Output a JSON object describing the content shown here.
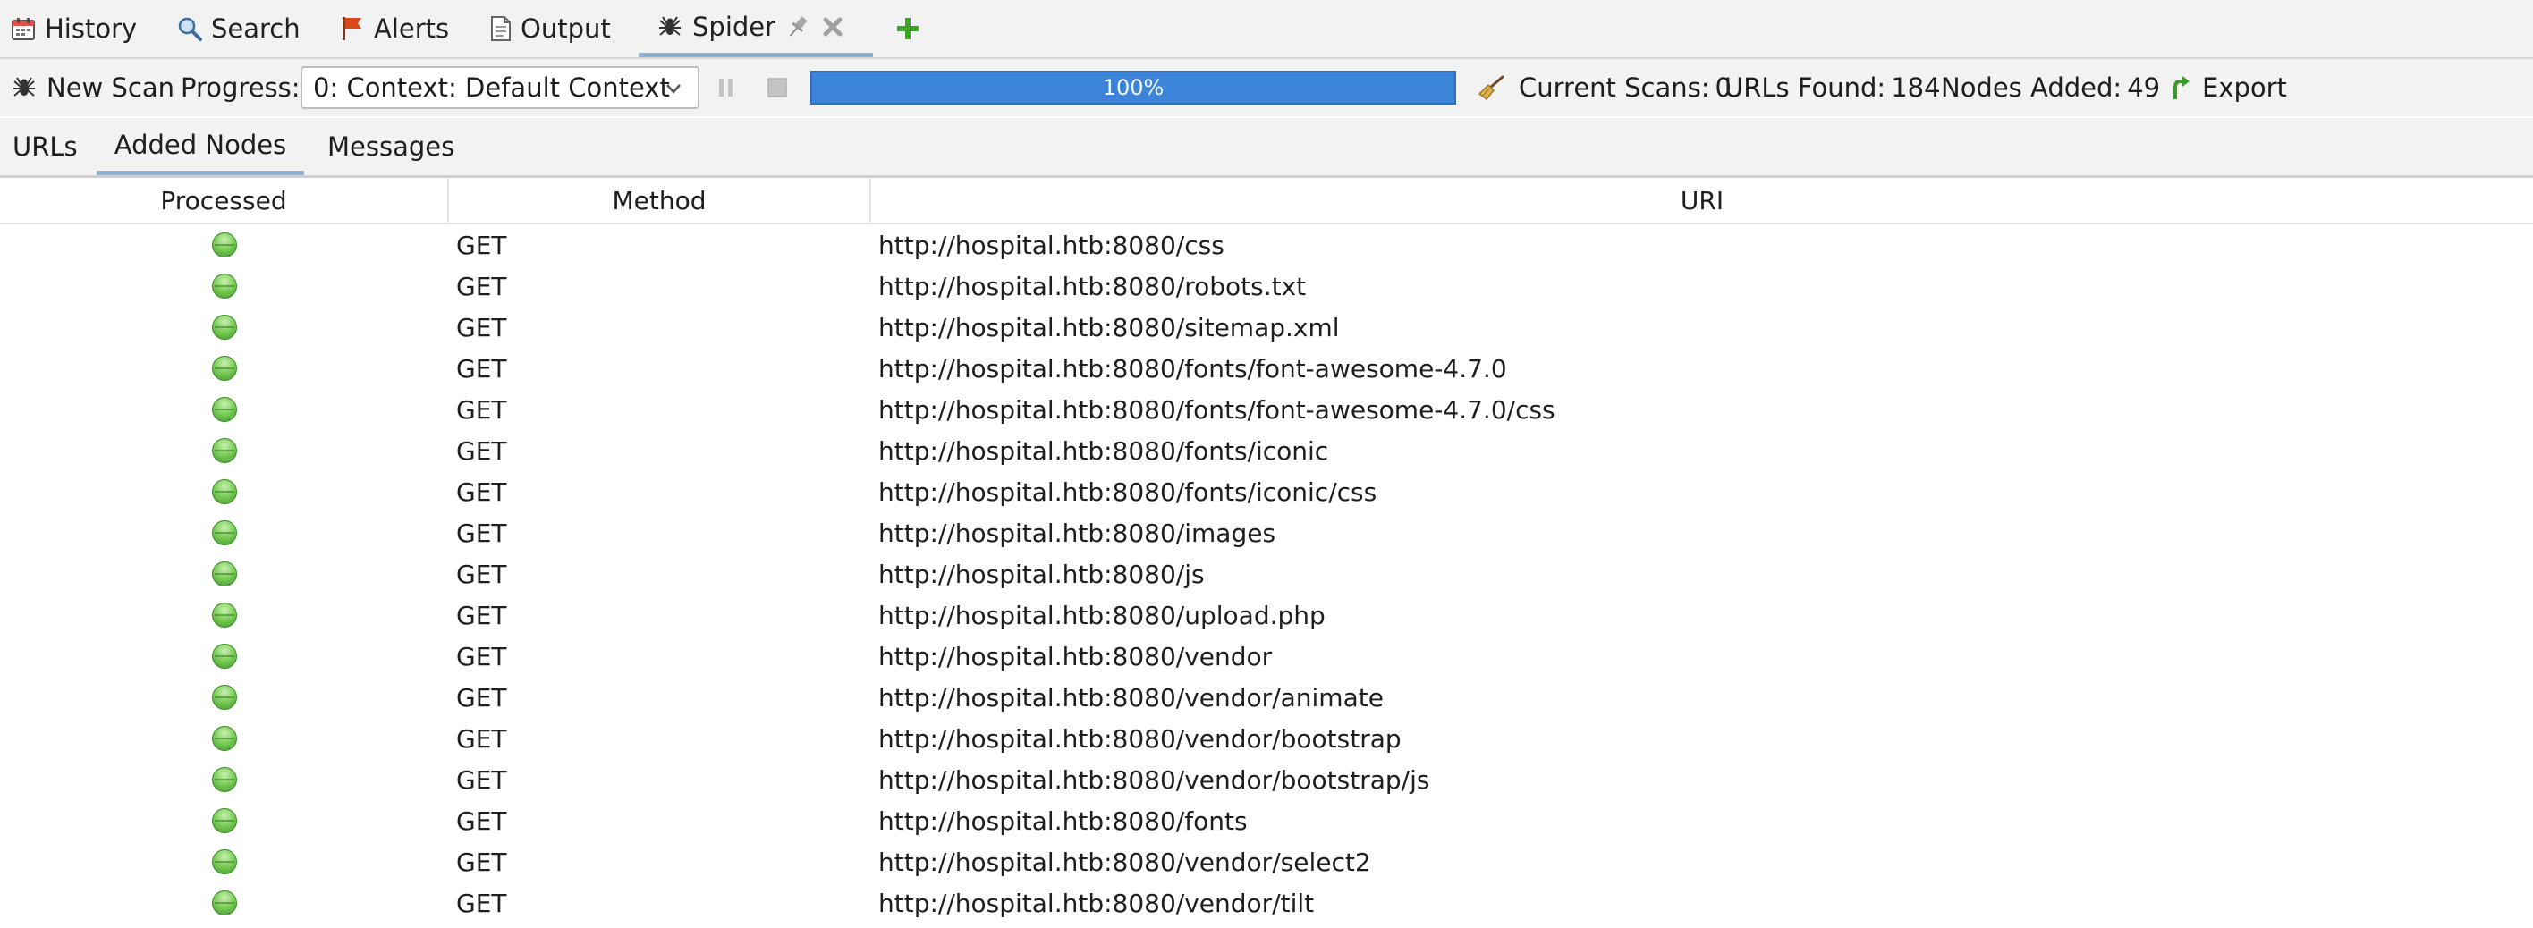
{
  "tabs": [
    {
      "label": "History",
      "icon": "calendar-icon"
    },
    {
      "label": "Search",
      "icon": "magnifier-icon"
    },
    {
      "label": "Alerts",
      "icon": "flag-icon"
    },
    {
      "label": "Output",
      "icon": "document-icon"
    },
    {
      "label": "Spider",
      "icon": "spider-icon",
      "active": true
    }
  ],
  "toolbar": {
    "new_scan_label": "New Scan",
    "progress_label": "Progress:",
    "context_value": "0: Context: Default Context",
    "progress_percent": 100,
    "progress_text": "100%",
    "current_scans_label": "Current Scans:",
    "current_scans_value": "0",
    "urls_found_label": "URLs Found:",
    "urls_found_value": "184",
    "nodes_added_label": "Nodes Added:",
    "nodes_added_value": "49",
    "export_label": "Export"
  },
  "subtabs": [
    {
      "label": "URLs"
    },
    {
      "label": "Added Nodes",
      "active": true
    },
    {
      "label": "Messages"
    }
  ],
  "table": {
    "columns": [
      "Processed",
      "Method",
      "URI"
    ],
    "rows": [
      {
        "processed": true,
        "method": "GET",
        "uri": "http://hospital.htb:8080/css"
      },
      {
        "processed": true,
        "method": "GET",
        "uri": "http://hospital.htb:8080/robots.txt"
      },
      {
        "processed": true,
        "method": "GET",
        "uri": "http://hospital.htb:8080/sitemap.xml"
      },
      {
        "processed": true,
        "method": "GET",
        "uri": "http://hospital.htb:8080/fonts/font-awesome-4.7.0"
      },
      {
        "processed": true,
        "method": "GET",
        "uri": "http://hospital.htb:8080/fonts/font-awesome-4.7.0/css"
      },
      {
        "processed": true,
        "method": "GET",
        "uri": "http://hospital.htb:8080/fonts/iconic"
      },
      {
        "processed": true,
        "method": "GET",
        "uri": "http://hospital.htb:8080/fonts/iconic/css"
      },
      {
        "processed": true,
        "method": "GET",
        "uri": "http://hospital.htb:8080/images"
      },
      {
        "processed": true,
        "method": "GET",
        "uri": "http://hospital.htb:8080/js"
      },
      {
        "processed": true,
        "method": "GET",
        "uri": "http://hospital.htb:8080/upload.php"
      },
      {
        "processed": true,
        "method": "GET",
        "uri": "http://hospital.htb:8080/vendor"
      },
      {
        "processed": true,
        "method": "GET",
        "uri": "http://hospital.htb:8080/vendor/animate"
      },
      {
        "processed": true,
        "method": "GET",
        "uri": "http://hospital.htb:8080/vendor/bootstrap"
      },
      {
        "processed": true,
        "method": "GET",
        "uri": "http://hospital.htb:8080/vendor/bootstrap/js"
      },
      {
        "processed": true,
        "method": "GET",
        "uri": "http://hospital.htb:8080/fonts"
      },
      {
        "processed": true,
        "method": "GET",
        "uri": "http://hospital.htb:8080/vendor/select2"
      },
      {
        "processed": true,
        "method": "GET",
        "uri": "http://hospital.htb:8080/vendor/tilt"
      }
    ]
  },
  "colors": {
    "progress_fill": "#3b84d8",
    "processed_ok": "#5cb83c",
    "active_tab_underline": "#8db3d9"
  }
}
